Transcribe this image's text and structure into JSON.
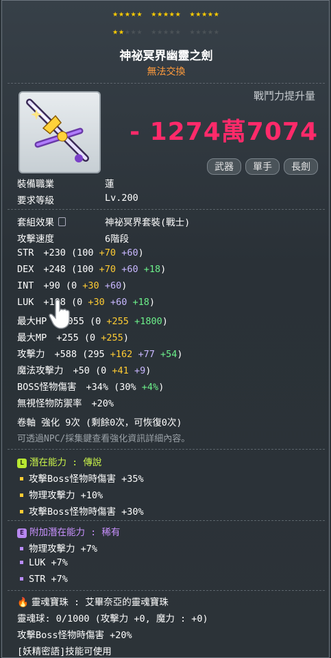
{
  "stars": {
    "rows": [
      [
        5,
        5,
        5
      ],
      [
        2,
        0,
        0
      ]
    ],
    "per_group": 5
  },
  "item": {
    "name": "神祕冥界幽靈之劍",
    "trade": "無法交換",
    "power_label": "戰鬥力提升量",
    "power_value": "- 1274萬7074",
    "tags": [
      "武器",
      "單手",
      "長劍"
    ]
  },
  "basic": {
    "job_label": "裝備職業",
    "job_value": "蓮",
    "level_label": "要求等級",
    "level_value": "Lv.200"
  },
  "set_label": "套組效果",
  "set_value": "神祕冥界套裝(戰士)",
  "speed_label": "攻擊速度",
  "speed_value": "6階段",
  "stats": [
    {
      "name": "STR",
      "parts": [
        [
          "+230 (100 ",
          ""
        ],
        [
          "+70",
          "yel"
        ],
        [
          " ",
          ""
        ],
        [
          "+60",
          "pur"
        ],
        [
          ")",
          ""
        ]
      ]
    },
    {
      "name": "DEX",
      "parts": [
        [
          "+248 (100 ",
          ""
        ],
        [
          "+70",
          "yel"
        ],
        [
          " ",
          ""
        ],
        [
          "+60",
          "pur"
        ],
        [
          " ",
          ""
        ],
        [
          "+18",
          "grn"
        ],
        [
          ")",
          ""
        ]
      ]
    },
    {
      "name": "INT",
      "parts": [
        [
          "+90 (0 ",
          ""
        ],
        [
          "+30",
          "yel"
        ],
        [
          " ",
          ""
        ],
        [
          "+60",
          "pur"
        ],
        [
          ")",
          ""
        ]
      ]
    },
    {
      "name": "LUK",
      "parts": [
        [
          "+108 (0 ",
          ""
        ],
        [
          "+30",
          "yel"
        ],
        [
          " ",
          ""
        ],
        [
          "+60",
          "pur"
        ],
        [
          " ",
          ""
        ],
        [
          "+18",
          "grn"
        ],
        [
          ")",
          ""
        ]
      ]
    },
    {
      "name": "最大HP",
      "parts": [
        [
          "+2055 (0 ",
          ""
        ],
        [
          "+255",
          "yel"
        ],
        [
          " ",
          ""
        ],
        [
          "+1800",
          "grn"
        ],
        [
          ")",
          ""
        ]
      ]
    },
    {
      "name": "最大MP",
      "parts": [
        [
          "+255 (0 ",
          ""
        ],
        [
          "+255",
          "yel"
        ],
        [
          ")",
          ""
        ]
      ]
    },
    {
      "name": "攻擊力",
      "parts": [
        [
          "+588 (295 ",
          ""
        ],
        [
          "+162",
          "yel"
        ],
        [
          " ",
          ""
        ],
        [
          "+77",
          "pur"
        ],
        [
          " ",
          ""
        ],
        [
          "+54",
          "grn"
        ],
        [
          ")",
          ""
        ]
      ]
    },
    {
      "name": "魔法攻擊力",
      "parts": [
        [
          "+50 (0 ",
          ""
        ],
        [
          "+41",
          "yel"
        ],
        [
          " ",
          ""
        ],
        [
          "+9",
          "pur"
        ],
        [
          ")",
          ""
        ]
      ]
    },
    {
      "name": "BOSS怪物傷害",
      "parts": [
        [
          "+34% (30% ",
          ""
        ],
        [
          "+4%",
          "grn"
        ],
        [
          ")",
          ""
        ]
      ]
    },
    {
      "name": "無視怪物防禦率",
      "parts": [
        [
          "+20%",
          ""
        ]
      ]
    }
  ],
  "scroll": "卷軸 強化 9次 (剩餘0次，可恢復0次)",
  "scroll_hint": "可透過NPC/採集鍵查看強化資訊詳細內容。",
  "potential": {
    "badge": "L",
    "label": "潛在能力 : 傳說",
    "lines": [
      "攻擊Boss怪物時傷害 +35%",
      "物理攻擊力 +10%",
      "攻擊Boss怪物時傷害 +30%"
    ]
  },
  "bonus": {
    "badge": "E",
    "label": "附加潛在能力 : 稀有",
    "lines": [
      "物理攻擊力 +7%",
      "LUK +7%",
      "STR +7%"
    ]
  },
  "soul": {
    "name": "靈魂寶珠 : 艾畢奈亞的靈魂寶珠",
    "line1": "靈魂球: 0/1000 (攻擊力 +0, 魔力 : +0)",
    "line2": "攻擊Boss怪物時傷害 +20%",
    "line3": "[妖精密語]技能可使用"
  },
  "colors": {
    "power": "#ff2a6a",
    "legend": "#c9f34a",
    "bonus": "#c991ff",
    "trade": "#ff9b3c",
    "star": "#ffcc00"
  }
}
